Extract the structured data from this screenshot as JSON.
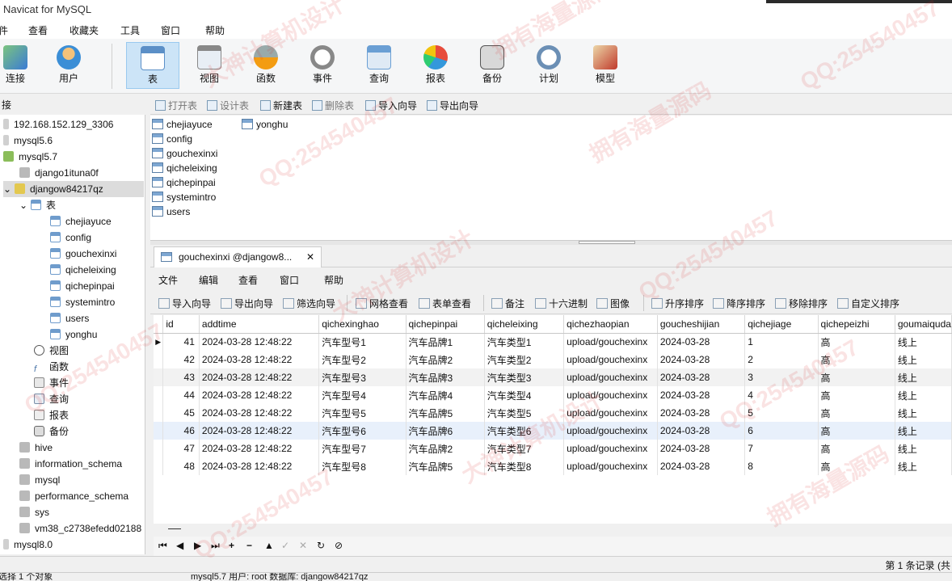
{
  "app": {
    "title": "Navicat for MySQL"
  },
  "menu": [
    "件",
    "查看",
    "收藏夹",
    "工具",
    "窗口",
    "帮助"
  ],
  "ribbon": [
    {
      "label": "连接",
      "icon": "connect-icon"
    },
    {
      "label": "用户",
      "icon": "user-icon"
    },
    {
      "label": "表",
      "icon": "table-icon"
    },
    {
      "label": "视图",
      "icon": "view-icon"
    },
    {
      "label": "函数",
      "icon": "function-icon"
    },
    {
      "label": "事件",
      "icon": "event-icon"
    },
    {
      "label": "查询",
      "icon": "query-icon"
    },
    {
      "label": "报表",
      "icon": "report-icon"
    },
    {
      "label": "备份",
      "icon": "backup-icon"
    },
    {
      "label": "计划",
      "icon": "schedule-icon"
    },
    {
      "label": "模型",
      "icon": "model-icon"
    }
  ],
  "left_header": "接",
  "tree": [
    "192.168.152.129_3306",
    "mysql5.6",
    "mysql5.7",
    "django1ituna0f",
    "djangow84217qz",
    "表",
    "chejiayuce",
    "config",
    "gouchexinxi",
    "qicheleixing",
    "qichepinpai",
    "systemintro",
    "users",
    "yonghu",
    "视图",
    "函数",
    "事件",
    "查询",
    "报表",
    "备份",
    "hive",
    "information_schema",
    "mysql",
    "performance_schema",
    "sys",
    "vm38_c2738efedd02188",
    "mysql8.0"
  ],
  "objbar": [
    "打开表",
    "设计表",
    "新建表",
    "删除表",
    "导入向导",
    "导出向导"
  ],
  "objects": [
    "chejiayuce",
    "config",
    "gouchexinxi",
    "qicheleixing",
    "qichepinpai",
    "systemintro",
    "users",
    "yonghu"
  ],
  "tab": {
    "title": "gouchexinxi @djangow8...",
    "close": "✕"
  },
  "grid_menu": [
    "文件",
    "编辑",
    "查看",
    "窗口",
    "帮助"
  ],
  "grid_toolbar": [
    "导入向导",
    "导出向导",
    "筛选向导",
    "网格查看",
    "表单查看",
    "备注",
    "十六进制",
    "图像",
    "升序排序",
    "降序排序",
    "移除排序",
    "自定义排序"
  ],
  "columns": [
    "id",
    "addtime",
    "qichexinghao",
    "qichepinpai",
    "qicheleixing",
    "qichezhaopian",
    "goucheshijian",
    "qichejiage",
    "qichepeizhi",
    "goumaiquda"
  ],
  "rows": [
    [
      "41",
      "2024-03-28 12:48:22",
      "汽车型号1",
      "汽车品牌1",
      "汽车类型1",
      "upload/gouchexinx",
      "2024-03-28",
      "1",
      "高",
      "线上"
    ],
    [
      "42",
      "2024-03-28 12:48:22",
      "汽车型号2",
      "汽车品牌2",
      "汽车类型2",
      "upload/gouchexinx",
      "2024-03-28",
      "2",
      "高",
      "线上"
    ],
    [
      "43",
      "2024-03-28 12:48:22",
      "汽车型号3",
      "汽车品牌3",
      "汽车类型3",
      "upload/gouchexinx",
      "2024-03-28",
      "3",
      "高",
      "线上"
    ],
    [
      "44",
      "2024-03-28 12:48:22",
      "汽车型号4",
      "汽车品牌4",
      "汽车类型4",
      "upload/gouchexinx",
      "2024-03-28",
      "4",
      "高",
      "线上"
    ],
    [
      "45",
      "2024-03-28 12:48:22",
      "汽车型号5",
      "汽车品牌5",
      "汽车类型5",
      "upload/gouchexinx",
      "2024-03-28",
      "5",
      "高",
      "线上"
    ],
    [
      "46",
      "2024-03-28 12:48:22",
      "汽车型号6",
      "汽车品牌6",
      "汽车类型6",
      "upload/gouchexinx",
      "2024-03-28",
      "6",
      "高",
      "线上"
    ],
    [
      "47",
      "2024-03-28 12:48:22",
      "汽车型号7",
      "汽车品牌2",
      "汽车类型7",
      "upload/gouchexinx",
      "2024-03-28",
      "7",
      "高",
      "线上"
    ],
    [
      "48",
      "2024-03-28 12:48:22",
      "汽车型号8",
      "汽车品牌5",
      "汽车类型8",
      "upload/gouchexinx",
      "2024-03-28",
      "8",
      "高",
      "线上"
    ]
  ],
  "nav_buttons": [
    "⏮",
    "◀",
    "▶",
    "⏭",
    "+",
    "−",
    "▲",
    "✓",
    "✕",
    "↻",
    "⊘"
  ],
  "status": {
    "left": "选择 1 个对象",
    "record": "第 1 条记录 (共",
    "bottom": "mysql5.7   用户: root   数据库: djangow84217qz"
  },
  "watermarks": [
    "拥有海量源码",
    "大神计算机设计",
    "QQ:254540457"
  ]
}
